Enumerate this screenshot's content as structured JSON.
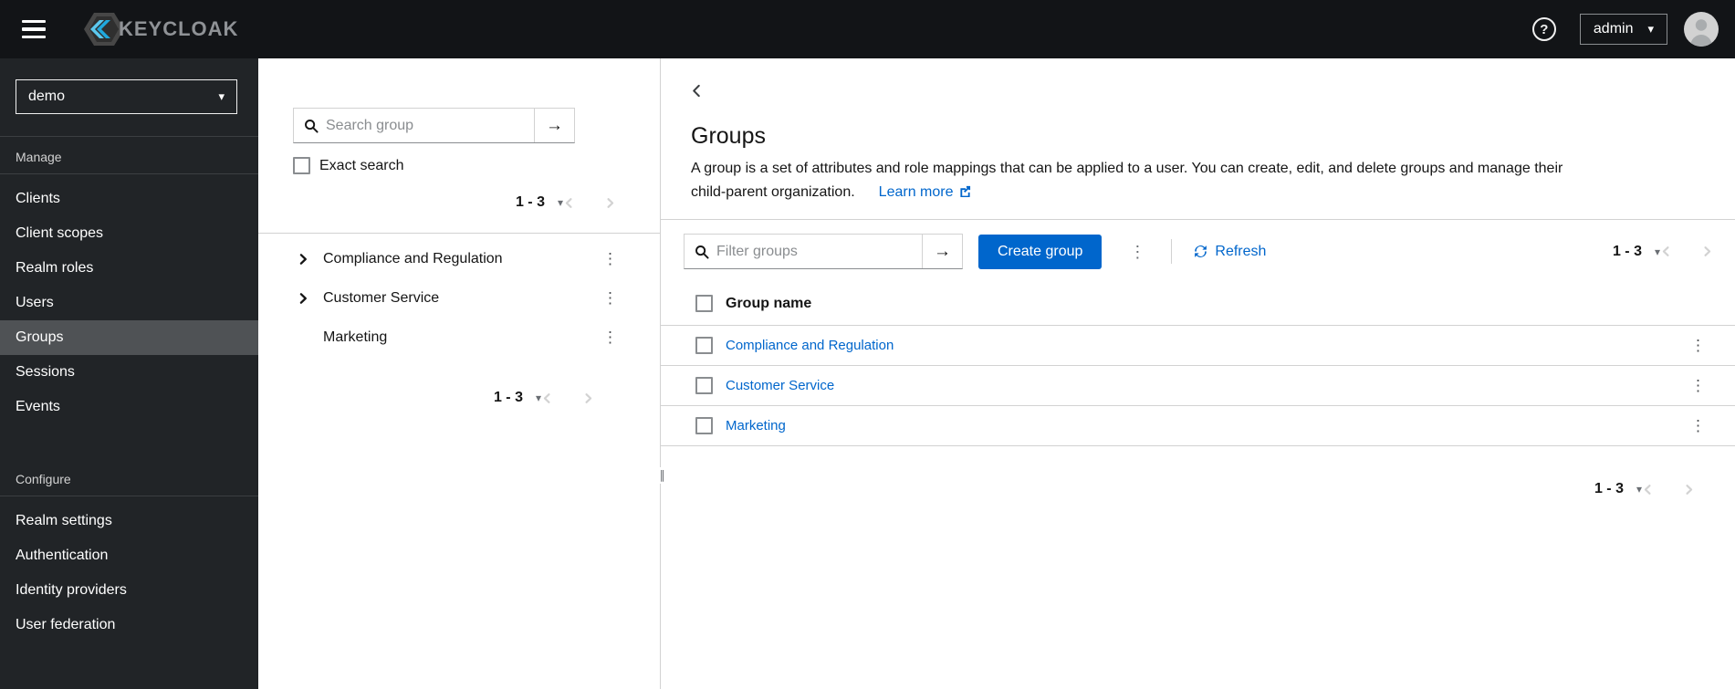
{
  "icons": {
    "caret_down": "▾",
    "kebab": "⋮",
    "arrow_right": "→",
    "question": "?",
    "drag_handle": "∥"
  },
  "masthead": {
    "brand": "KEYCLOAK",
    "user_menu": {
      "label": "admin"
    }
  },
  "sidebar": {
    "realm_selector": {
      "value": "demo"
    },
    "sections": [
      {
        "title": "Manage",
        "items": [
          "Clients",
          "Client scopes",
          "Realm roles",
          "Users",
          "Groups",
          "Sessions",
          "Events"
        ],
        "selected": "Groups"
      },
      {
        "title": "Configure",
        "items": [
          "Realm settings",
          "Authentication",
          "Identity providers",
          "User federation"
        ]
      }
    ]
  },
  "group_tree_panel": {
    "search": {
      "placeholder": "Search group",
      "value": ""
    },
    "exact_search_label": "Exact search",
    "pagination_top": {
      "range": "1 - 3"
    },
    "items": [
      {
        "label": "Compliance and Regulation",
        "expandable": true
      },
      {
        "label": "Customer Service",
        "expandable": true
      },
      {
        "label": "Marketing",
        "expandable": false
      }
    ],
    "pagination_bottom": {
      "range": "1 - 3"
    }
  },
  "main": {
    "title": "Groups",
    "description_line1": "A group is a set of attributes and role mappings that can be applied to a user. You can create, edit, and delete groups and manage their",
    "description_line2": "child-parent organization.",
    "learn_more_label": "Learn more",
    "toolbar": {
      "filter": {
        "placeholder": "Filter groups",
        "value": ""
      },
      "create_button_label": "Create group",
      "refresh_label": "Refresh",
      "pagination": {
        "range": "1 - 3"
      }
    },
    "table": {
      "header": "Group name",
      "rows": [
        "Compliance and Regulation",
        "Customer Service",
        "Marketing"
      ]
    },
    "bottom_pagination": {
      "range": "1 - 3"
    }
  },
  "colors": {
    "primary": "#0066cc",
    "link": "#0066cc",
    "masthead_bg": "#121417",
    "sidebar_bg": "#212427",
    "selected_nav_bg": "#4f5255",
    "border": "#d2d2d2",
    "logo_cyan": "#3cb4e5"
  }
}
